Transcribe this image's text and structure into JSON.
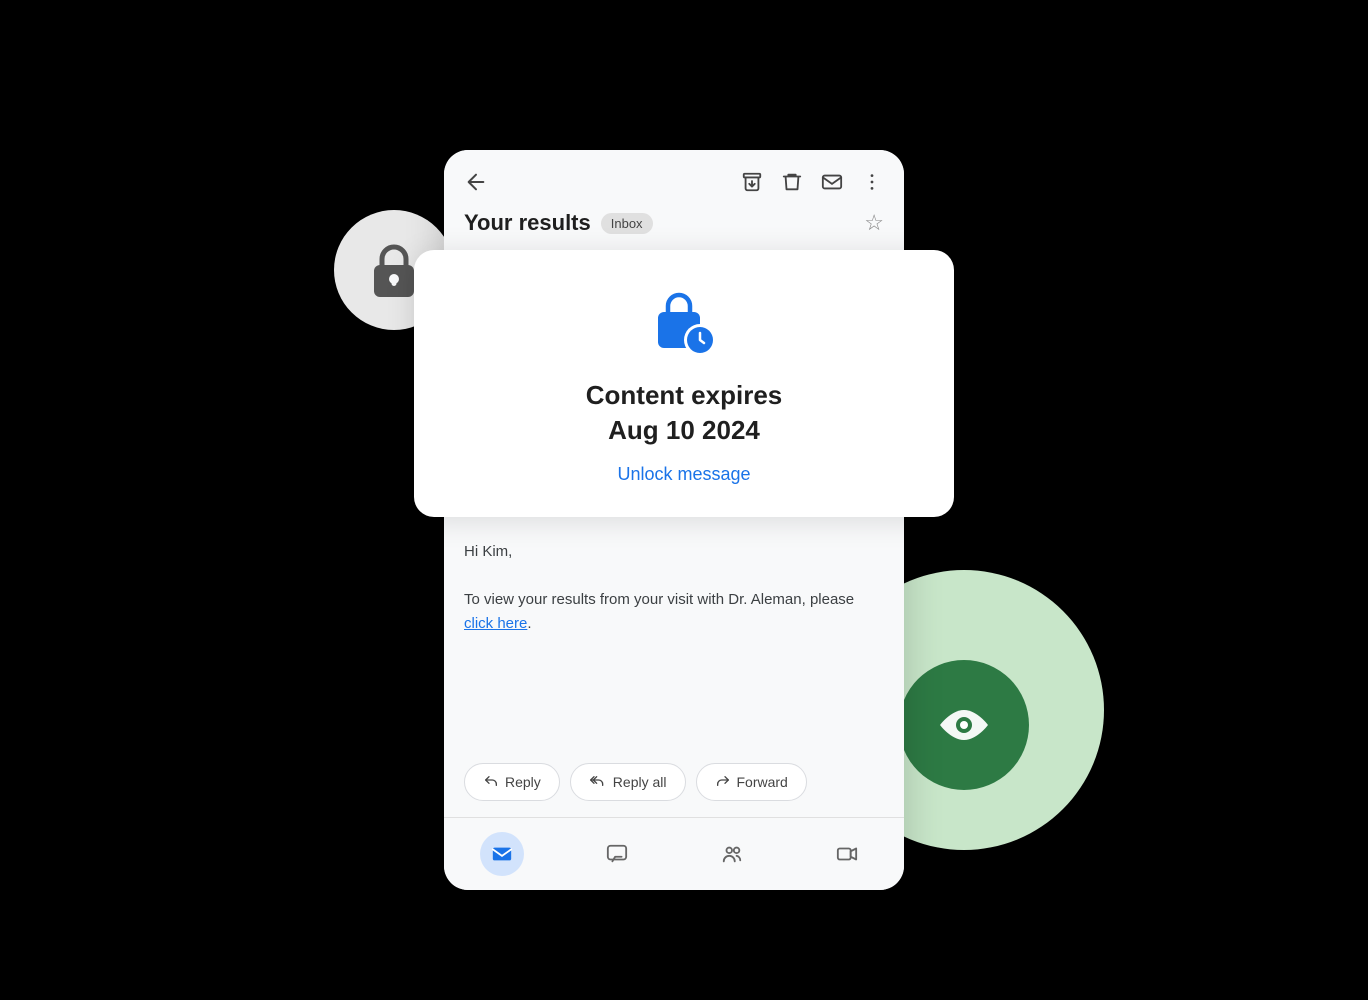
{
  "scene": {
    "email_card": {
      "subject": "Your results",
      "badge": "Inbox",
      "body_greeting": "Hi Kim,",
      "body_text": "To view your results from your visit with Dr. Aleman, please ",
      "body_link": "click here",
      "body_end": "."
    },
    "expires_card": {
      "title_line1": "Content expires",
      "title_line2": "Aug 10 2024",
      "unlock_label": "Unlock message"
    },
    "reply_buttons": [
      {
        "label": "Reply",
        "icon": "reply"
      },
      {
        "label": "Reply all",
        "icon": "reply-all"
      },
      {
        "label": "Forward",
        "icon": "forward"
      }
    ],
    "bottom_nav": [
      {
        "label": "Mail",
        "active": true
      },
      {
        "label": "Chat",
        "active": false
      },
      {
        "label": "Meet",
        "active": false
      },
      {
        "label": "Video",
        "active": false
      }
    ]
  }
}
